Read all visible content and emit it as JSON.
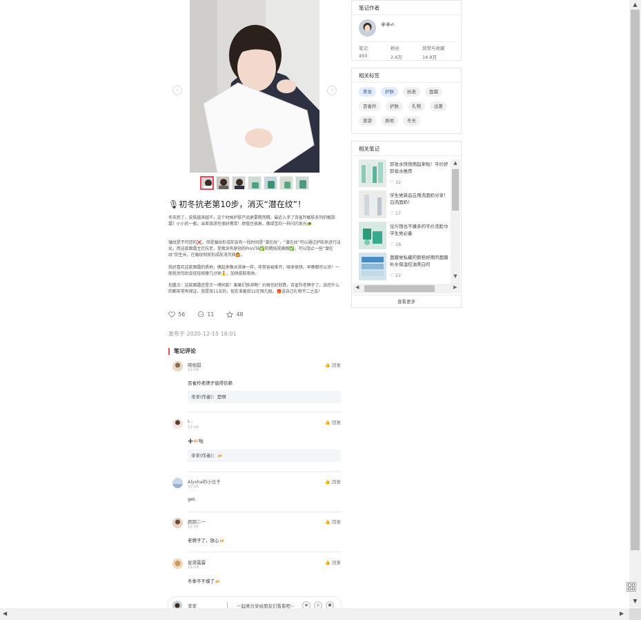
{
  "note": {
    "title": "初冬抗老第10步，消灭“潜在纹”！",
    "title_icon": "🎙",
    "paragraphs": [
      "冬天到了，皮肤越来越干，这个时候护肤产品更要精而精。最近入手了百雀羚敏肤系列的敏肤霜！小小的一瓶，出差旅游也很好携带！颜值也很高，像绿宝石一样闪闪发光🐢",
      "皱纹是不可逆的❌，但是皱纹形成前会有一段时间是“潜在纹”，“潜在纹”可以通过护肤来进行淡化。而这款面霜主打抗老，里面含有原创的ProVTA✅和精纯视黄醇✅，可以阻止一些“潜在纹”的生长，在皱纹彻底形成前消灭掉🙆。",
      "我好喜欢这款面霜的质地，摸起来像冰淇淋一样，非常容易推开，吸收很快。早晚都可以涂！一般我涂完后会轻轻按摩几分钟🧘，加快皮肤吸收。",
      "划重点：这款面霜还是王一博同款！果果们快冲啊！价格也好划算，百雀羚老牌子了，品控什么的都非常有保证。我是双11买的，现在准备双12在囤几瓶。🎁送自己礼物不二之选！"
    ],
    "likes": "56",
    "comments_count": "11",
    "collects": "48",
    "published": "发布于 2020-12-15 18:01"
  },
  "comments_section": {
    "header": "笔记评论",
    "like_label": "回复",
    "items": [
      {
        "name": "晓桓甜",
        "date": "12-16",
        "text": "百雀羚老牌子值得信赖",
        "reply": "辛辛(作者)：是啊"
      },
      {
        "name": "L ·",
        "date": "12-16",
        "text": "➕🐖啦",
        "reply": "辛辛(作者)：🍻"
      },
      {
        "name": "Alysha的小日子",
        "date": "12-16",
        "text": "get",
        "reply": ""
      },
      {
        "name": "颜颜二一",
        "date": "12-16",
        "text": "老牌子了，放心🍻",
        "reply": ""
      },
      {
        "name": "星黛露露",
        "date": "12-16",
        "text": "冬季不干燥了🍻",
        "reply": ""
      }
    ]
  },
  "bottom_bar": {
    "name": "辛辛",
    "share_text": "一起来分享给朋友们看看吧~"
  },
  "author_card": {
    "title": "笔记作者",
    "name": "辛辛✍",
    "stats": [
      {
        "label": "笔记",
        "value": "450"
      },
      {
        "label": "粉丝",
        "value": "2.6万"
      },
      {
        "label": "获赞与收藏",
        "value": "14.9万"
      }
    ]
  },
  "tags_card": {
    "title": "相关标签",
    "tags": [
      "美妆",
      "护肤",
      "抗老",
      "面霜",
      "百雀羚",
      "护肤",
      "礼物",
      "出差",
      "旅游",
      "质地",
      "冬天"
    ]
  },
  "related_card": {
    "title": "相关笔记",
    "items": [
      {
        "text": "卸妆水快快用起来啦！平价好用卸妆水推荐",
        "likes": "32"
      },
      {
        "text": "学生党新品白用洗面奶分享！美白洗面奶！",
        "likes": "17"
      },
      {
        "text": "论斤囤也不嫌多的平价洗脸巾🔴学生党必备",
        "likes": "16"
      },
      {
        "text": "面膜党私藏的那些好用的面膜！补水保湿控油美白的",
        "likes": "22"
      }
    ],
    "more": "查看更多"
  },
  "colors": {
    "accent": "#e74c5c",
    "tag_highlight": "#e3ecfb"
  }
}
